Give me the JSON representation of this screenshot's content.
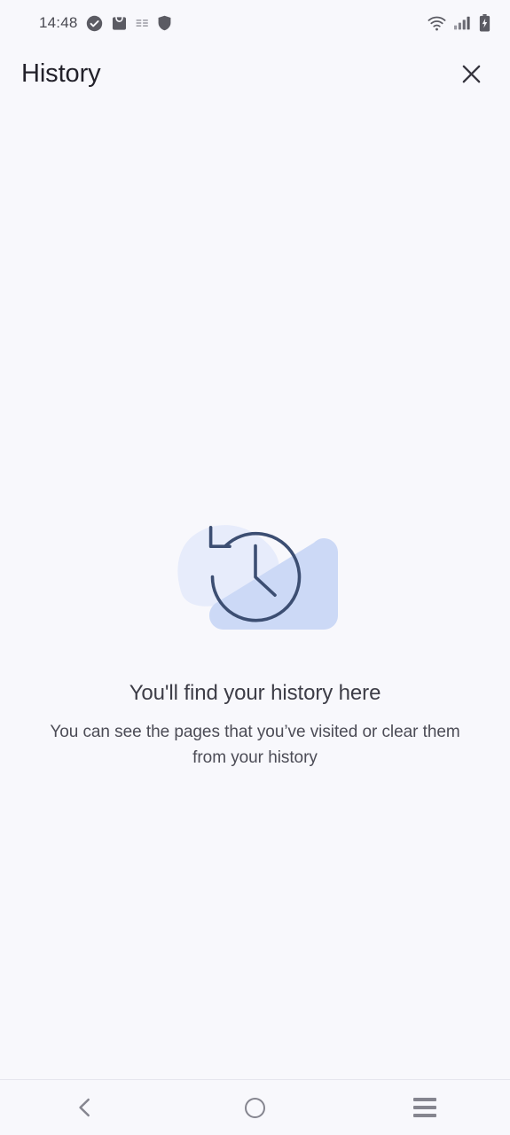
{
  "status_bar": {
    "time": "14:48",
    "left_icons": [
      {
        "name": "check-circle-icon",
        "glyph": "check-circle"
      },
      {
        "name": "shopping-bag-icon",
        "glyph": "bag"
      },
      {
        "name": "text-badge-icon",
        "glyph": "badge"
      },
      {
        "name": "shield-icon",
        "glyph": "shield"
      }
    ],
    "right_icons": [
      {
        "name": "wifi-icon",
        "glyph": "wifi"
      },
      {
        "name": "cellular-signal-icon",
        "glyph": "signal"
      },
      {
        "name": "battery-charging-icon",
        "glyph": "battery"
      }
    ]
  },
  "header": {
    "title": "History",
    "close_label": "Close"
  },
  "empty_state": {
    "title": "You'll find your history here",
    "subtitle": "You can see the pages that you’ve visited or clear them from your history",
    "illustration_name": "history-clock-illustration"
  },
  "nav_bar": {
    "back_label": "Back",
    "home_label": "Home",
    "recents_label": "Recent apps"
  },
  "colors": {
    "background": "#f8f8fc",
    "title_text": "#22212a",
    "body_text": "#4c4c56",
    "status_icon": "#5b5b63",
    "nav_icon": "#85858f",
    "blob_light": "#e7ecfb",
    "blob_mid": "#ccd9f6",
    "clock_stroke": "#3c4e72",
    "divider": "#e6e6ee"
  }
}
